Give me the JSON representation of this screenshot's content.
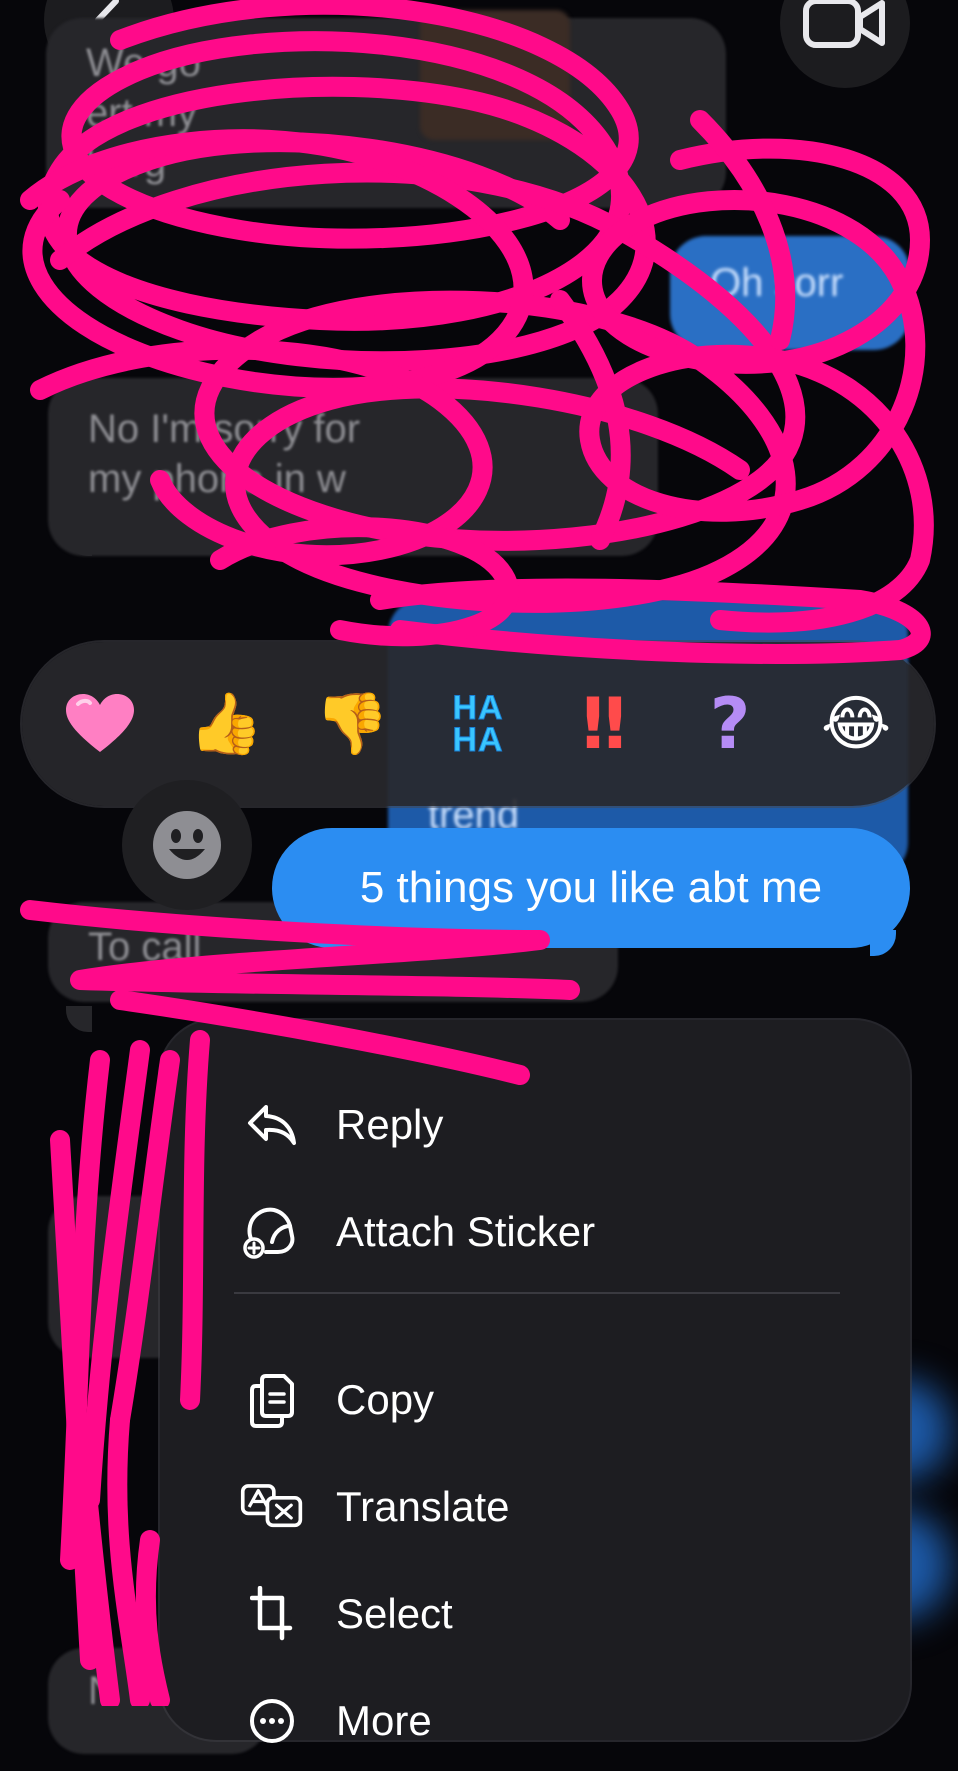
{
  "conversation": {
    "background_messages": [
      {
        "id": "in1",
        "direction": "incoming",
        "text": "We go"
      },
      {
        "id": "in1b",
        "direction": "incoming",
        "text": "ert my"
      },
      {
        "id": "in1c",
        "direction": "incoming",
        "text": "harg"
      },
      {
        "id": "out1",
        "direction": "outgoing",
        "text": "Oh sorr"
      },
      {
        "id": "in2",
        "direction": "incoming",
        "text": "No I'm sorry for"
      },
      {
        "id": "in2b",
        "direction": "incoming",
        "text": "my phone in   w"
      },
      {
        "id": "out2",
        "direction": "outgoing",
        "text": "trend"
      },
      {
        "id": "in3",
        "direction": "incoming",
        "text": "To call"
      },
      {
        "id": "in4",
        "direction": "incoming",
        "text": "N"
      }
    ]
  },
  "reaction_bar": {
    "reactions": [
      {
        "name": "heart",
        "glyph": "❤"
      },
      {
        "name": "thumbs-up",
        "glyph": "👍"
      },
      {
        "name": "thumbs-down",
        "glyph": "👎"
      },
      {
        "name": "haha",
        "glyph": "HA\nHA"
      },
      {
        "name": "emphasize",
        "glyph": "‼"
      },
      {
        "name": "question",
        "glyph": "?"
      },
      {
        "name": "laugh",
        "glyph": "😂"
      }
    ]
  },
  "selected_message": {
    "text": "5 things you like abt me"
  },
  "context_menu": {
    "items": [
      {
        "label": "Reply",
        "icon": "reply-icon"
      },
      {
        "label": "Attach Sticker",
        "icon": "sticker-icon"
      },
      {
        "label": "Copy",
        "icon": "copy-icon"
      },
      {
        "label": "Translate",
        "icon": "translate-icon"
      },
      {
        "label": "Select",
        "icon": "crop-select-icon"
      },
      {
        "label": "More",
        "icon": "more-icon"
      }
    ]
  },
  "colors": {
    "background": "#06060a",
    "bubble_out": "#2b8df2",
    "bubble_in": "#26262a",
    "menu_bg": "#1d1d21",
    "scribble": "#ff0a8a"
  }
}
